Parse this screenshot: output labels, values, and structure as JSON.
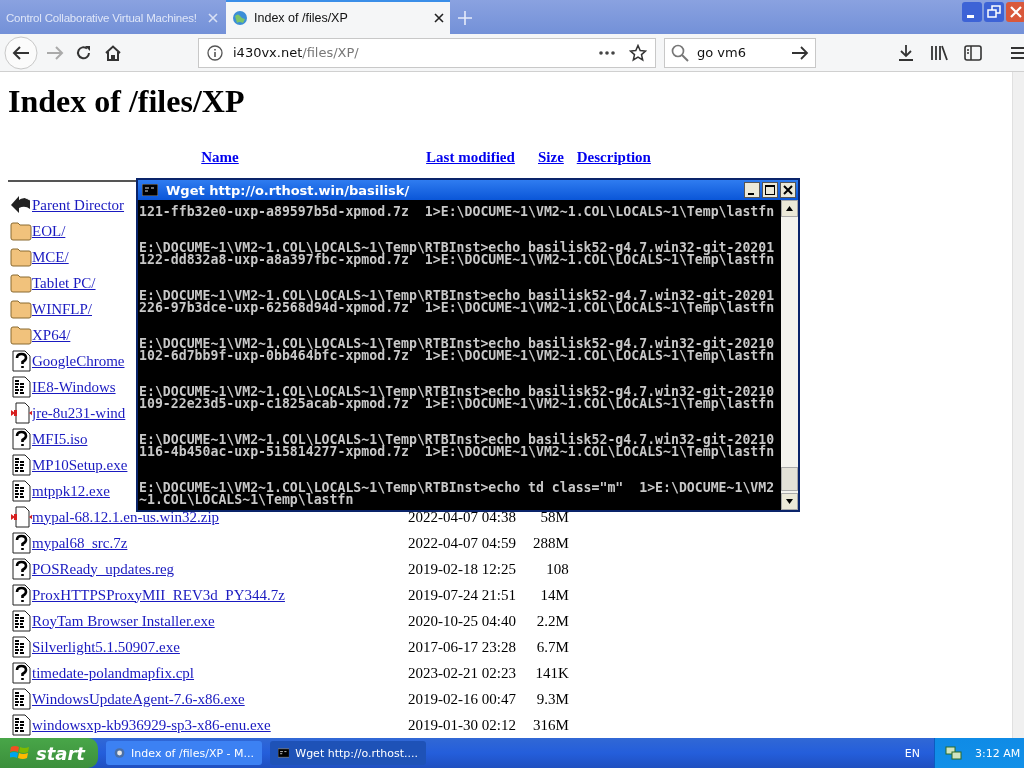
{
  "browser": {
    "tabs": [
      {
        "title": "Control Collaborative Virtual Machines!",
        "selected": false
      },
      {
        "title": "Index of /files/XP",
        "selected": true
      }
    ],
    "address": {
      "host": "i430vx.net",
      "path": "/files/XP/"
    },
    "search": {
      "value": "go vm6"
    }
  },
  "page": {
    "heading": "Index of /files/XP",
    "columns": [
      "Name",
      "Last modified",
      "Size",
      "Description"
    ],
    "rows": [
      {
        "kind": "back",
        "name": "Parent Director"
      },
      {
        "kind": "folder",
        "name": "EOL/"
      },
      {
        "kind": "folder",
        "name": "MCE/"
      },
      {
        "kind": "folder",
        "name": "Tablet PC/"
      },
      {
        "kind": "folder",
        "name": "WINFLP/"
      },
      {
        "kind": "folder",
        "name": "XP64/"
      },
      {
        "kind": "unknown",
        "name": "GoogleChrome"
      },
      {
        "kind": "binary",
        "name": "IE8-Windows"
      },
      {
        "kind": "compressed",
        "name": "jre-8u231-wind"
      },
      {
        "kind": "unknown",
        "name": "MFI5.iso"
      },
      {
        "kind": "binary",
        "name": "MP10Setup.exe"
      },
      {
        "kind": "binary",
        "name": "mtppk12.exe"
      },
      {
        "kind": "compressed",
        "name": "mypal-68.12.1.en-us.win32.zip",
        "modified": "2022-04-07 04:38",
        "size": "58M"
      },
      {
        "kind": "unknown",
        "name": "mypal68_src.7z",
        "modified": "2022-04-07 04:59",
        "size": "288M"
      },
      {
        "kind": "unknown",
        "name": "POSReady_updates.reg",
        "modified": "2019-02-18 12:25",
        "size": "108"
      },
      {
        "kind": "unknown",
        "name": "ProxHTTPSProxyMII_REV3d_PY344.7z",
        "modified": "2019-07-24 21:51",
        "size": "14M"
      },
      {
        "kind": "binary",
        "name": "RoyTam Browser Installer.exe",
        "modified": "2020-10-25 04:40",
        "size": "2.2M"
      },
      {
        "kind": "binary",
        "name": "Silverlight5.1.50907.exe",
        "modified": "2017-06-17 23:28",
        "size": "6.7M"
      },
      {
        "kind": "unknown",
        "name": "timedate-polandmapfix.cpl",
        "modified": "2023-02-21 02:23",
        "size": "141K"
      },
      {
        "kind": "binary",
        "name": "WindowsUpdateAgent-7.6-x86.exe",
        "modified": "2019-02-16 00:47",
        "size": "9.3M"
      },
      {
        "kind": "binary",
        "name": "windowsxp-kb936929-sp3-x86-enu.exe",
        "modified": "2019-01-30 02:12",
        "size": "316M"
      }
    ]
  },
  "console": {
    "title": "Wget http://o.rthost.win/basilisk/",
    "blocks": [
      [
        "121-ffb32e0-uxp-a89597b5d-xpmod.7z  1>E:\\DOCUME~1\\VM2~1.COL\\LOCALS~1\\Temp\\lastfn"
      ],
      [
        "E:\\DOCUME~1\\VM2~1.COL\\LOCALS~1\\Temp\\RTBInst>echo basilisk52-g4.7.win32-git-20201",
        "122-dd832a8-uxp-a8a397fbc-xpmod.7z  1>E:\\DOCUME~1\\VM2~1.COL\\LOCALS~1\\Temp\\lastfn"
      ],
      [
        "E:\\DOCUME~1\\VM2~1.COL\\LOCALS~1\\Temp\\RTBInst>echo basilisk52-g4.7.win32-git-20201",
        "226-97b3dce-uxp-62568d94d-xpmod.7z  1>E:\\DOCUME~1\\VM2~1.COL\\LOCALS~1\\Temp\\lastfn"
      ],
      [
        "E:\\DOCUME~1\\VM2~1.COL\\LOCALS~1\\Temp\\RTBInst>echo basilisk52-g4.7.win32-git-20210",
        "102-6d7bb9f-uxp-0bb464bfc-xpmod.7z  1>E:\\DOCUME~1\\VM2~1.COL\\LOCALS~1\\Temp\\lastfn"
      ],
      [
        "E:\\DOCUME~1\\VM2~1.COL\\LOCALS~1\\Temp\\RTBInst>echo basilisk52-g4.7.win32-git-20210",
        "109-22e23d5-uxp-c1825acab-xpmod.7z  1>E:\\DOCUME~1\\VM2~1.COL\\LOCALS~1\\Temp\\lastfn"
      ],
      [
        "E:\\DOCUME~1\\VM2~1.COL\\LOCALS~1\\Temp\\RTBInst>echo basilisk52-g4.7.win32-git-20210",
        "116-4b450ac-uxp-515814277-xpmod.7z  1>E:\\DOCUME~1\\VM2~1.COL\\LOCALS~1\\Temp\\lastfn"
      ],
      [
        "E:\\DOCUME~1\\VM2~1.COL\\LOCALS~1\\Temp\\RTBInst>echo td class=\"m\"  1>E:\\DOCUME~1\\VM2",
        "~1.COL\\LOCALS~1\\Temp\\lastfn"
      ]
    ]
  },
  "taskbar": {
    "start": "start",
    "tasks": [
      {
        "kind": "browser",
        "label": "Index of /files/XP - M...",
        "selected": false
      },
      {
        "kind": "console",
        "label": "Wget http://o.rthost....",
        "selected": true
      }
    ],
    "language": "EN",
    "clock": "3:12 AM"
  }
}
